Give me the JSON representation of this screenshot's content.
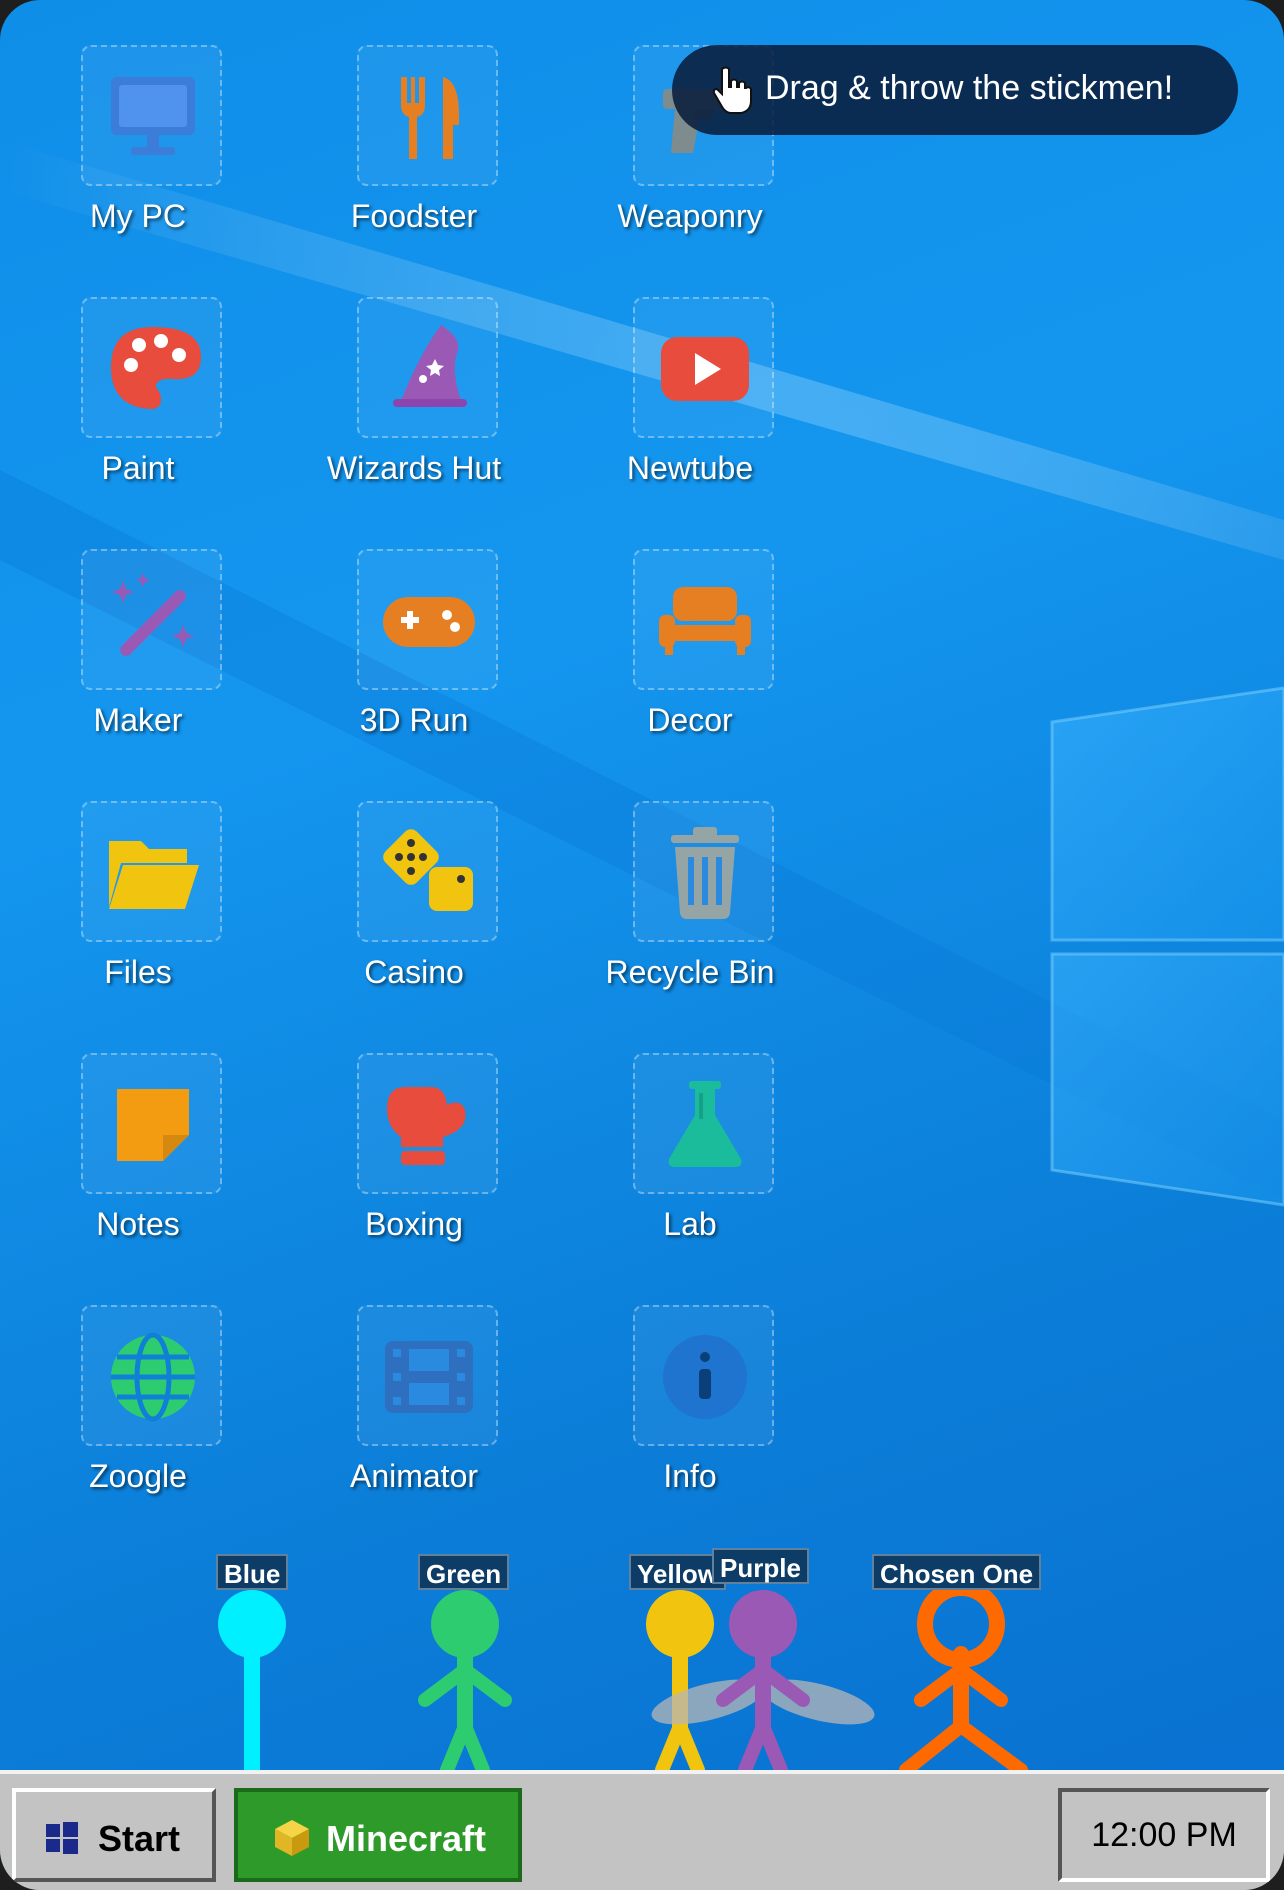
{
  "toast": {
    "text": "Drag & throw the stickmen!",
    "icon": "hand-pointer-icon"
  },
  "desktop_icons": [
    {
      "label": "My PC",
      "icon": "monitor-icon"
    },
    {
      "label": "Foodster",
      "icon": "fork-knife-icon"
    },
    {
      "label": "Weaponry",
      "icon": "gun-icon"
    },
    {
      "label": "Paint",
      "icon": "palette-icon"
    },
    {
      "label": "Wizards Hut",
      "icon": "wizard-hat-icon"
    },
    {
      "label": "Newtube",
      "icon": "youtube-play-icon"
    },
    {
      "label": "Maker",
      "icon": "magic-wand-icon"
    },
    {
      "label": "3D Run",
      "icon": "gamepad-icon"
    },
    {
      "label": "Decor",
      "icon": "couch-icon"
    },
    {
      "label": "Files",
      "icon": "folder-open-icon"
    },
    {
      "label": "Casino",
      "icon": "dice-icon"
    },
    {
      "label": "Recycle Bin",
      "icon": "trash-icon"
    },
    {
      "label": "Notes",
      "icon": "sticky-note-icon"
    },
    {
      "label": "Boxing",
      "icon": "boxing-glove-icon"
    },
    {
      "label": "Lab",
      "icon": "flask-icon"
    },
    {
      "label": "Zoogle",
      "icon": "globe-icon"
    },
    {
      "label": "Animator",
      "icon": "film-icon"
    },
    {
      "label": "Info",
      "icon": "info-icon"
    }
  ],
  "stickmen": [
    {
      "name": "Blue",
      "color": "#00f0ff"
    },
    {
      "name": "Green",
      "color": "#2ecc71"
    },
    {
      "name": "Yellow",
      "color": "#f1c40f"
    },
    {
      "name": "Purple",
      "color": "#9b59b6"
    },
    {
      "name": "Chosen One",
      "color": "#ff6a00"
    }
  ],
  "taskbar": {
    "start_label": "Start",
    "app_label": "Minecraft",
    "clock": "12:00 PM"
  },
  "colors": {
    "taskbar": "#c3c3c3",
    "minecraft_button": "#2e9a2a",
    "toast_bg": "#0a1e3c"
  }
}
